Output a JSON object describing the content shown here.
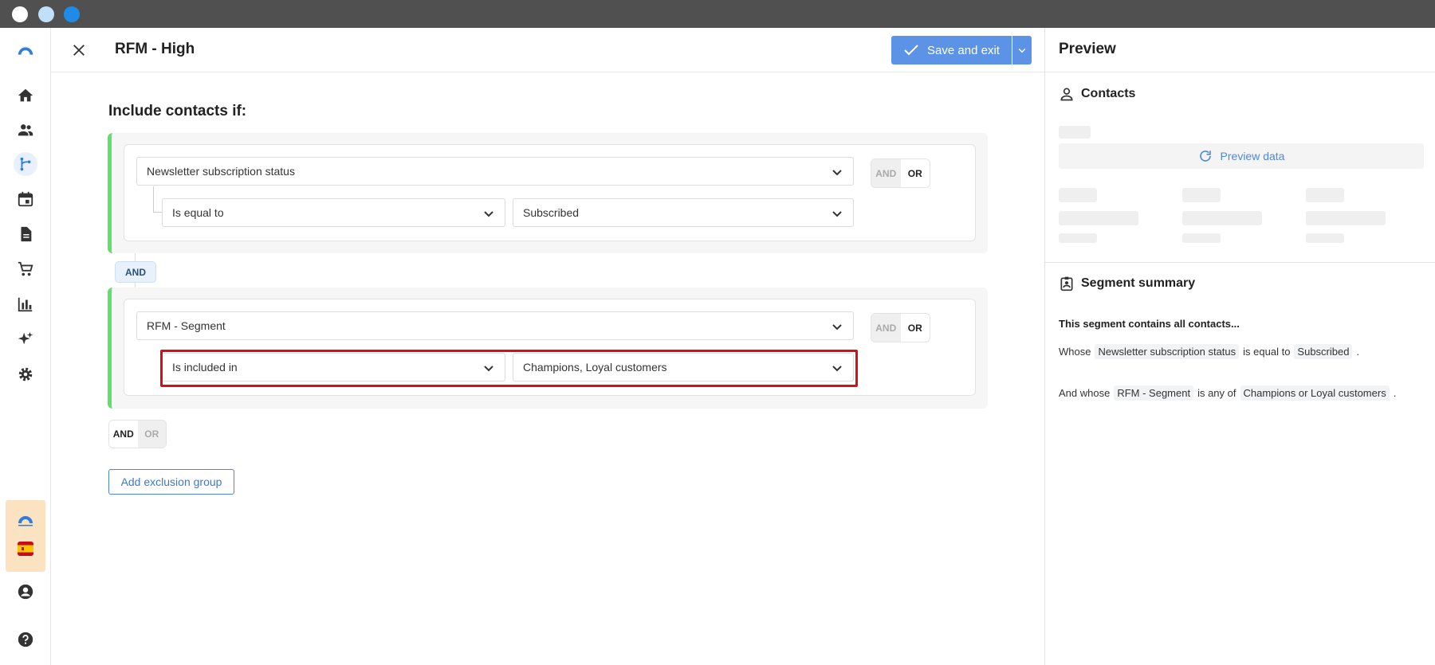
{
  "header": {
    "title": "RFM - High",
    "save_label": "Save and exit"
  },
  "builder": {
    "include_title": "Include contacts if:",
    "groups": [
      {
        "field": "Newsletter subscription status",
        "operator": "Is equal to",
        "value": "Subscribed",
        "toggle_and": "AND",
        "toggle_or": "OR"
      },
      {
        "field": "RFM - Segment",
        "operator": "Is included in",
        "value": "Champions, Loyal customers",
        "toggle_and": "AND",
        "toggle_or": "OR"
      }
    ],
    "between_label": "AND",
    "group_toggle": {
      "and": "AND",
      "or": "OR"
    },
    "exclusion_button": "Add exclusion group"
  },
  "preview": {
    "title": "Preview",
    "contacts_label": "Contacts",
    "preview_data_label": "Preview data",
    "summary_label": "Segment summary",
    "summary_lead": "This segment contains all contacts...",
    "line1": {
      "prefix": "Whose",
      "field": "Newsletter subscription status",
      "op": "is equal to",
      "value": "Subscribed",
      "end": "."
    },
    "line2": {
      "prefix": "And whose",
      "field": "RFM - Segment",
      "op": "is any of",
      "value": "Champions or Loyal customers",
      "end": "."
    }
  },
  "nav": {
    "icons": [
      "home-icon",
      "contacts-icon",
      "automation-icon",
      "calendar-icon",
      "document-icon",
      "cart-icon",
      "analytics-icon",
      "sparkles-icon",
      "settings-icon",
      "account-icon",
      "help-icon"
    ]
  },
  "colors": {
    "accent": "#5c93e6",
    "group_border": "#5ee06a",
    "highlight": "#d80e16"
  }
}
